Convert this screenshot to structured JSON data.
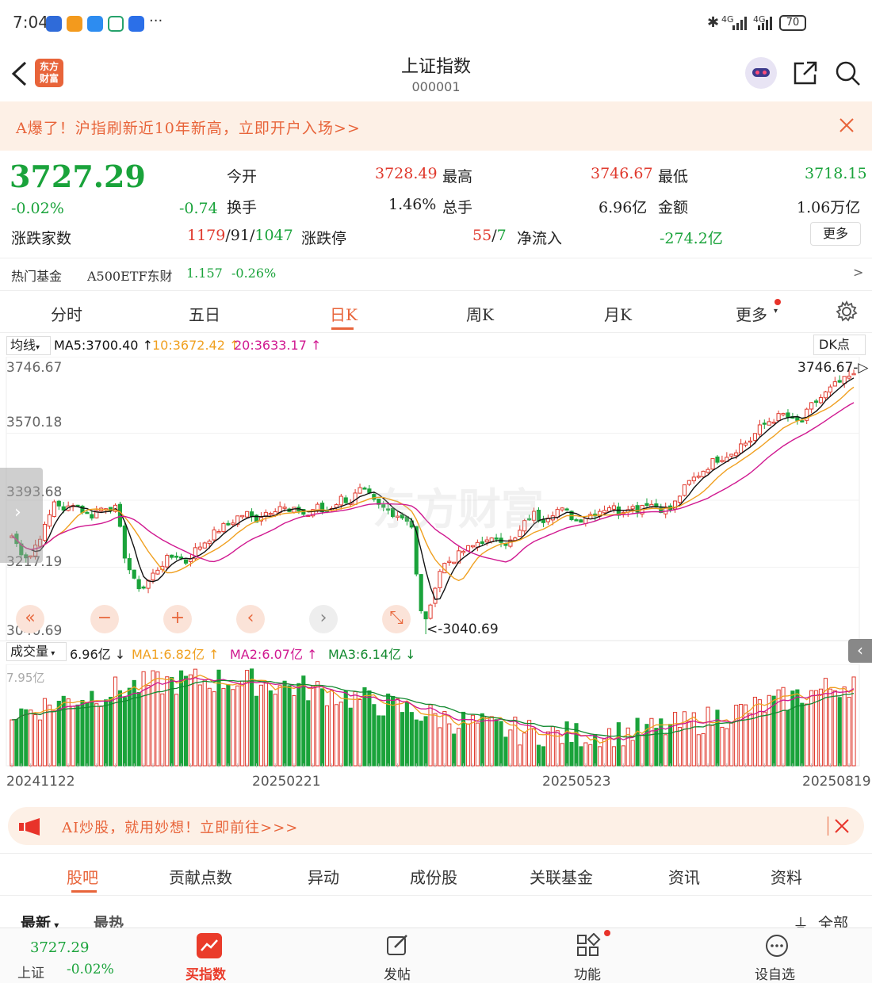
{
  "status_bar": {
    "time": "7:04",
    "dots": "···",
    "net1": "4G",
    "net2": "4G",
    "battery": "70"
  },
  "header": {
    "title": "上证指数",
    "code": "000001",
    "logo_line1": "东方",
    "logo_line2": "财富"
  },
  "promo": {
    "text": "A爆了！沪指刷新近10年新高，立即开户入场>>"
  },
  "quote": {
    "price": "3727.29",
    "pct": "-0.02%",
    "change": "-0.74",
    "open_label": "今开",
    "open": "3728.49",
    "high_label": "最高",
    "high": "3746.67",
    "low_label": "最低",
    "low": "3718.15",
    "turnover_label": "换手",
    "turnover": "1.46%",
    "volume_label": "总手",
    "volume": "6.96亿",
    "amount_label": "金额",
    "amount": "1.06万亿",
    "breadth_label": "涨跌家数",
    "breadth_up": "1179",
    "breadth_flat": "91",
    "breadth_down": "1047",
    "limit_label": "涨跌停",
    "limit_up": "55",
    "limit_down": "7",
    "netflow_label": "净流入",
    "netflow": "-274.2亿",
    "more_label": "更多"
  },
  "fund": {
    "label": "热门基金",
    "name": "A500ETF东财",
    "price": "1.157",
    "pct": "-0.26%",
    "arrow": ">"
  },
  "period_tabs": [
    "分时",
    "五日",
    "日K",
    "周K",
    "月K",
    "更多"
  ],
  "ma": {
    "label": "均线",
    "ma5": "MA5:3700.40 ↑",
    "ma10": "10:3672.42 ↑",
    "ma20": "20:3633.17 ↑",
    "dk": "DK点"
  },
  "kline": {
    "y_labels": [
      "3746.67",
      "3570.18",
      "3393.68",
      "3217.19",
      "3040.69"
    ],
    "high_tag": "3746.67-▷",
    "low_tag": "<-3040.69",
    "watermark": "东方财富"
  },
  "vol": {
    "label": "成交量",
    "current": "6.96亿 ↓",
    "ma1": "MA1:6.82亿 ↑",
    "ma2": "MA2:6.07亿 ↑",
    "ma3": "MA3:6.14亿 ↓",
    "max_label": "7.95亿"
  },
  "dates": [
    "20241122",
    "20250221",
    "20250523",
    "20250819"
  ],
  "ad": {
    "text": "AI炒股，就用妙想！立即前往>>>"
  },
  "bottom_tabs": [
    "股吧",
    "贡献点数",
    "异动",
    "成份股",
    "关联基金",
    "资讯",
    "资料"
  ],
  "feed": {
    "latest": "最新",
    "hot": "最热",
    "all": "全部"
  },
  "navbar": {
    "price": "3727.29",
    "name": "上证",
    "pct": "-0.02%",
    "buy": "买指数",
    "post": "发帖",
    "func": "功能",
    "watch": "设自选"
  },
  "colors": {
    "up": "#e03a2e",
    "down": "#1aa33b",
    "accent": "#e8643a",
    "ma5": "#111111",
    "ma10": "#f0a020",
    "ma20": "#d01890"
  },
  "chart_data": {
    "type": "candlestick",
    "y_axis_labels": [
      3746.67,
      3570.18,
      3393.68,
      3217.19,
      3040.69
    ],
    "ylim": [
      3040.69,
      3746.67
    ],
    "x_labels": [
      "20241122",
      "20250221",
      "20250523",
      "20250819"
    ],
    "high": 3746.67,
    "low": 3040.69,
    "close_path": [
      3300,
      3260,
      3240,
      3290,
      3330,
      3400,
      3360,
      3390,
      3370,
      3350,
      3370,
      3380,
      3370,
      3250,
      3180,
      3160,
      3190,
      3220,
      3240,
      3250,
      3230,
      3260,
      3280,
      3300,
      3320,
      3330,
      3350,
      3360,
      3340,
      3360,
      3370,
      3380,
      3360,
      3370,
      3350,
      3380,
      3360,
      3380,
      3400,
      3390,
      3420,
      3410,
      3380,
      3370,
      3360,
      3350,
      3340,
      3100,
      3080,
      3200,
      3230,
      3240,
      3260,
      3270,
      3290,
      3280,
      3300,
      3280,
      3290,
      3330,
      3360,
      3340,
      3360,
      3370,
      3360,
      3340,
      3350,
      3360,
      3370,
      3380,
      3360,
      3380,
      3370,
      3390,
      3380,
      3370,
      3370,
      3410,
      3440,
      3460,
      3480,
      3500,
      3510,
      3520,
      3540,
      3550,
      3580,
      3600,
      3610,
      3620,
      3600,
      3600,
      3640,
      3660,
      3680,
      3700,
      3710,
      3727
    ],
    "volume": {
      "ylim": [
        0,
        7.95
      ],
      "ma1": 6.82,
      "ma2": 6.07,
      "ma3": 6.14,
      "current": 6.96
    }
  }
}
